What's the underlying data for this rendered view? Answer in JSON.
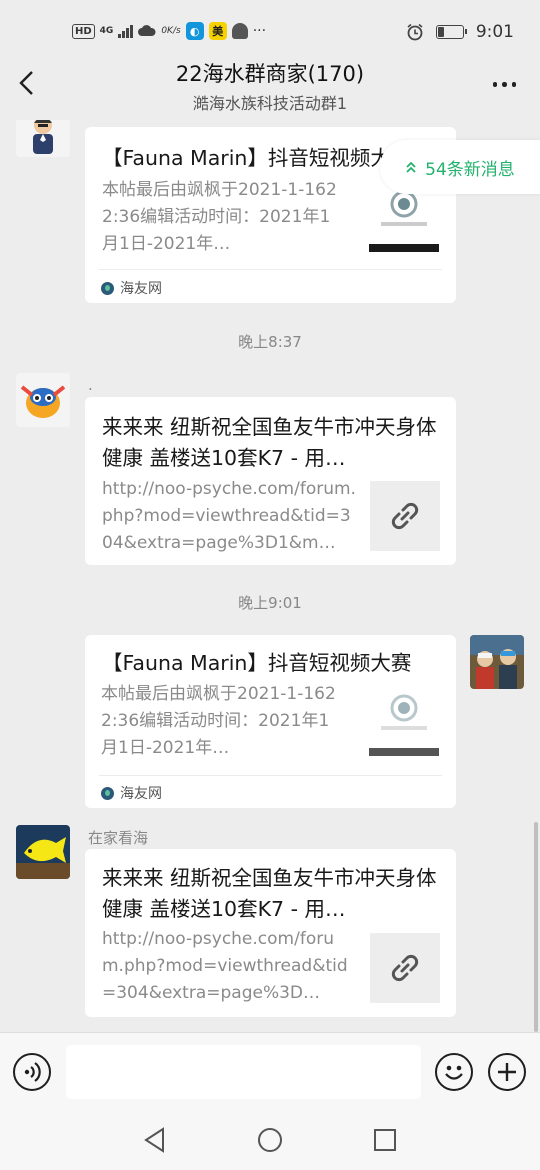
{
  "status_bar": {
    "hd": "HD",
    "network": "4G",
    "speed": "0K/s",
    "app_tag": "美",
    "more": "···",
    "time": "9:01",
    "battery_level": 0.25
  },
  "header": {
    "title": "22海水群商家(170)",
    "subtitle": "澔海水族科技活动群1"
  },
  "new_messages": "54条新消息",
  "messages": [
    {
      "title": "【Fauna Marin】抖音短视频大赛",
      "desc": "本帖最后由飒枫于2021-1-1622:36编辑活动时间：2021年1月1日-2021年…",
      "source": "海友网"
    },
    {
      "time": "晚上8:37",
      "sender": ".",
      "title": "来来来 纽斯祝全国鱼友牛市冲天身体健康 盖楼送10套K7 - 用…",
      "desc": "http://noo-psyche.com/forum.php?mod=viewthread&tid=304&extra=page%3D1&m…"
    },
    {
      "time": "晚上9:01",
      "title": "【Fauna Marin】抖音短视频大赛",
      "desc": "本帖最后由飒枫于2021-1-1622:36编辑活动时间：2021年1月1日-2021年…",
      "source": "海友网"
    },
    {
      "sender": "在家看海",
      "title": "来来来 纽斯祝全国鱼友牛市冲天身体健康 盖楼送10套K7 - 用…",
      "desc": "http://noo-psyche.com/forum.php?mod=viewthread&tid=304&extra=page%3D…"
    }
  ],
  "input": {
    "placeholder": ""
  },
  "icons": {
    "back": "chevron-left-icon",
    "more": "more-dots-icon",
    "voice": "voice-icon",
    "emoji": "emoji-icon",
    "plus": "plus-icon",
    "link": "link-icon"
  },
  "colors": {
    "accent": "#23b26d",
    "background": "#ededed",
    "card": "#ffffff"
  }
}
